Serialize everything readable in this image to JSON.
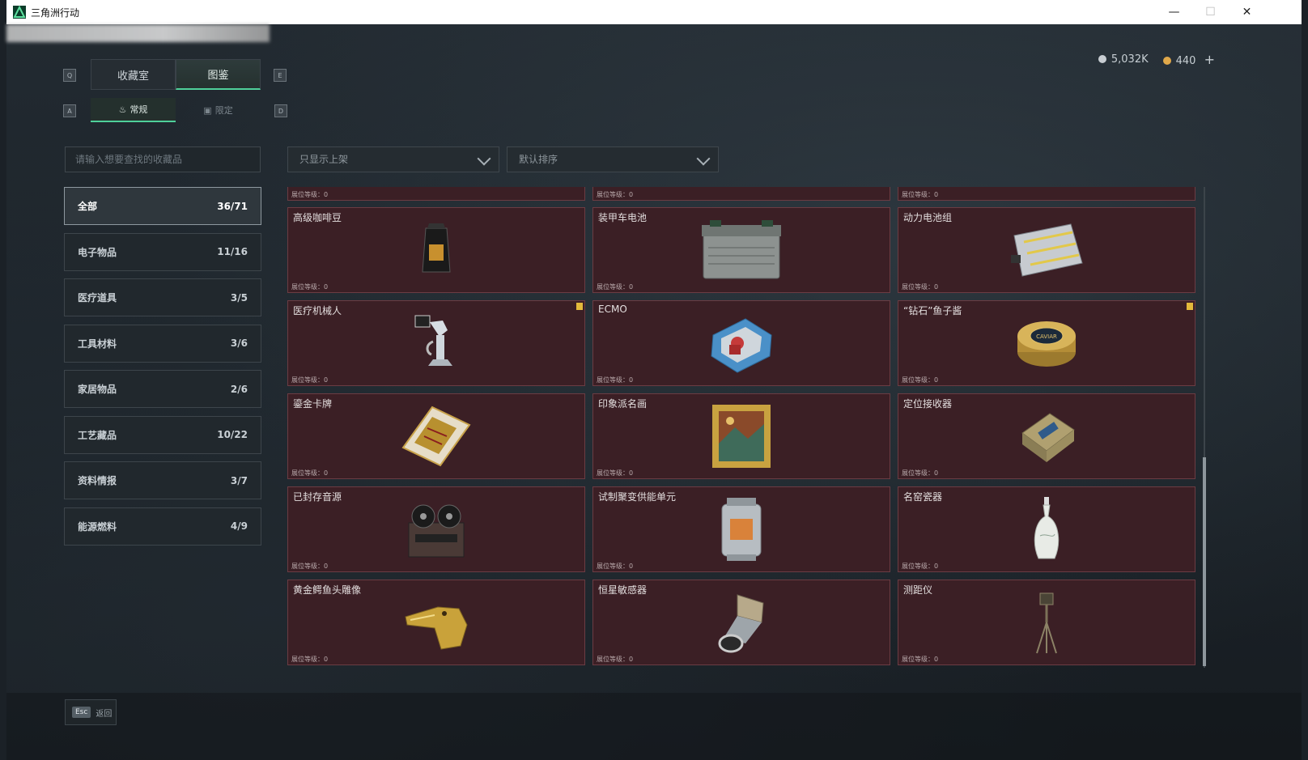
{
  "window": {
    "title": "三角洲行动",
    "minimize": "—",
    "maximize": "☐",
    "close": "✕"
  },
  "hotkeys": {
    "q": "Q",
    "e": "E",
    "a": "A",
    "d": "D"
  },
  "tabs": [
    {
      "label": "收藏室",
      "active": false
    },
    {
      "label": "图鉴",
      "active": true
    }
  ],
  "subtabs": [
    {
      "label": "常规",
      "active": true
    },
    {
      "label": "限定",
      "active": false
    }
  ],
  "currency": {
    "silver": {
      "value": "5,032K",
      "color": "#c8cdd2"
    },
    "gold": {
      "value": "440",
      "color": "#e0a84a"
    },
    "add": "+"
  },
  "search": {
    "placeholder": "请输入想要查找的收藏品"
  },
  "filters": {
    "display": "只显示上架",
    "sort": "默认排序"
  },
  "categories": [
    {
      "label": "全部",
      "count": "36/71",
      "active": true
    },
    {
      "label": "电子物品",
      "count": "11/16"
    },
    {
      "label": "医疗道具",
      "count": "3/5"
    },
    {
      "label": "工具材料",
      "count": "3/6"
    },
    {
      "label": "家居物品",
      "count": "2/6"
    },
    {
      "label": "工艺藏品",
      "count": "10/22"
    },
    {
      "label": "资料情报",
      "count": "3/7"
    },
    {
      "label": "能源燃料",
      "count": "4/9"
    }
  ],
  "level_label": "展位等级：0",
  "items": [
    {
      "name": "高级咖啡豆",
      "icon": "coffee-bag-icon",
      "badge": false
    },
    {
      "name": "装甲车电池",
      "icon": "car-battery-icon",
      "badge": false
    },
    {
      "name": "动力电池组",
      "icon": "battery-pack-icon",
      "badge": false
    },
    {
      "name": "医疗机械人",
      "icon": "medical-robot-icon",
      "badge": true
    },
    {
      "name": "ECMO",
      "icon": "ecmo-icon",
      "badge": false
    },
    {
      "name": "“钻石”鱼子酱",
      "icon": "caviar-tin-icon",
      "badge": true
    },
    {
      "name": "鎏金卡牌",
      "icon": "gold-card-icon",
      "badge": false
    },
    {
      "name": "印象派名画",
      "icon": "painting-icon",
      "badge": false
    },
    {
      "name": "定位接收器",
      "icon": "gps-receiver-icon",
      "badge": false
    },
    {
      "name": "已封存音源",
      "icon": "reel-recorder-icon",
      "badge": false
    },
    {
      "name": "试制聚变供能单元",
      "icon": "fusion-cell-icon",
      "badge": false
    },
    {
      "name": "名窑瓷器",
      "icon": "porcelain-vase-icon",
      "badge": false
    },
    {
      "name": "黄金鳄鱼头雕像",
      "icon": "gold-croc-statue-icon",
      "badge": false
    },
    {
      "name": "恒星敏感器",
      "icon": "star-sensor-icon",
      "badge": false
    },
    {
      "name": "测距仪",
      "icon": "rangefinder-icon",
      "badge": false
    }
  ],
  "footer": {
    "esc_key": "Esc",
    "back_label": "返回"
  }
}
